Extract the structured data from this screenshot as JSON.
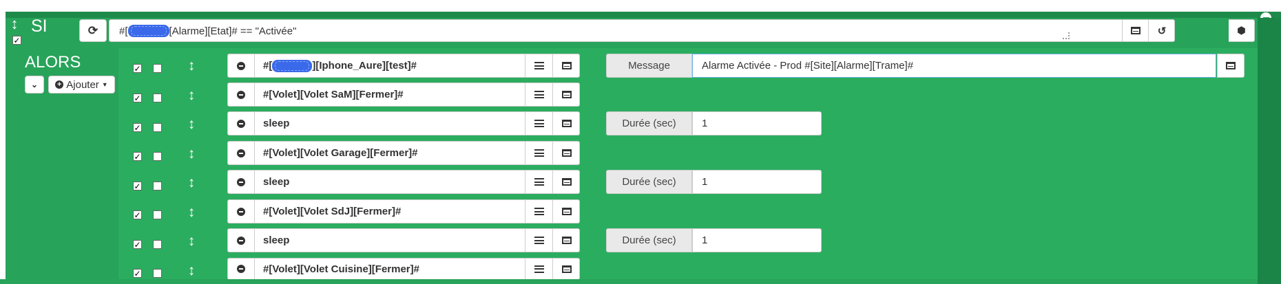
{
  "si": {
    "label": "SI",
    "condition_prefix": "#[",
    "condition_suffix": "[Alarme][Etat]# == \"Activée\"",
    "checked": true
  },
  "alors": {
    "label": "ALORS",
    "add_label": "Ajouter"
  },
  "actions": [
    {
      "cmd_prefix": "#[",
      "cmd_suffix": "][Iphone_Aure][test]#",
      "masked": true,
      "enabled": true,
      "param_label": "Message",
      "param_value": "Alarme Activée - Prod #[Site][Alarme][Trame]#"
    },
    {
      "cmd": "#[Volet][Volet SaM][Fermer]#",
      "enabled": true
    },
    {
      "cmd": "sleep",
      "enabled": true,
      "param_label": "Durée (sec)",
      "param_value": "1"
    },
    {
      "cmd": "#[Volet][Volet Garage][Fermer]#",
      "enabled": true
    },
    {
      "cmd": "sleep",
      "enabled": true,
      "param_label": "Durée (sec)",
      "param_value": "1"
    },
    {
      "cmd": "#[Volet][Volet SdJ][Fermer]#",
      "enabled": true
    },
    {
      "cmd": "sleep",
      "enabled": true,
      "param_label": "Durée (sec)",
      "param_value": "1"
    },
    {
      "cmd": "#[Volet][Volet Cuisine][Fermer]#",
      "enabled": true
    }
  ],
  "icons": {
    "refresh": "refresh-icon",
    "drag": "drag-handle-icon",
    "remove": "minus-circle-icon",
    "list": "list-icon",
    "table": "table-icon",
    "history": "history-icon",
    "cube": "cube-icon",
    "chevron": "chevron-down-icon",
    "plus": "plus-circle-icon"
  },
  "colors": {
    "block_bg": "#28a35a",
    "mask": "#2a5ee8"
  }
}
